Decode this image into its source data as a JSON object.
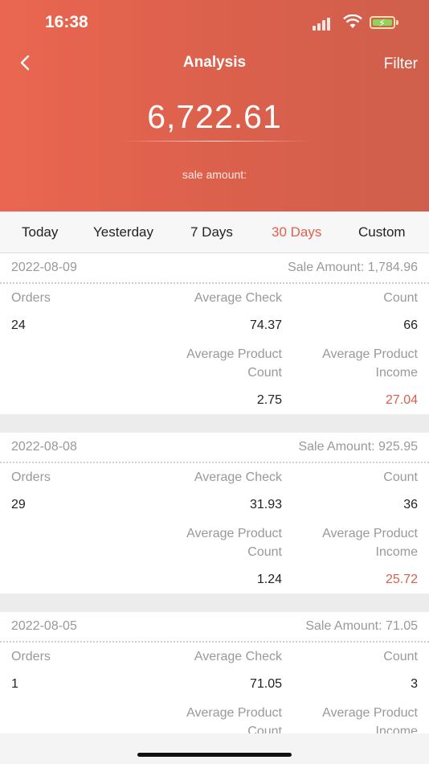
{
  "status_bar": {
    "time": "16:38"
  },
  "header": {
    "title": "Analysis",
    "filter_label": "Filter",
    "total_amount": "6,722.61",
    "amount_caption": "sale amount:"
  },
  "tabs": [
    {
      "label": "Today",
      "active": false
    },
    {
      "label": "Yesterday",
      "active": false
    },
    {
      "label": "7 Days",
      "active": false
    },
    {
      "label": "30 Days",
      "active": true
    },
    {
      "label": "Custom",
      "active": false
    }
  ],
  "colors": {
    "accent": "#E0604D",
    "header_start": "#EA6650",
    "header_end": "#CF5F4C"
  },
  "labels": {
    "orders": "Orders",
    "average_check": "Average Check",
    "count": "Count",
    "avg_product_count_1": "Average Product",
    "avg_product_count_2": "Count",
    "avg_product_income_1": "Average Product",
    "avg_product_income_2": "Income"
  },
  "records": [
    {
      "date": "2022-08-09",
      "sale_amount": "Sale Amount:  1,784.96",
      "orders": "24",
      "average_check": "74.37",
      "count": "66",
      "avg_product_count": "2.75",
      "avg_product_income": "27.04"
    },
    {
      "date": "2022-08-08",
      "sale_amount": "Sale Amount:  925.95",
      "orders": "29",
      "average_check": "31.93",
      "count": "36",
      "avg_product_count": "1.24",
      "avg_product_income": "25.72"
    },
    {
      "date": "2022-08-05",
      "sale_amount": "Sale Amount:  71.05",
      "orders": "1",
      "average_check": "71.05",
      "count": "3",
      "avg_product_count": "",
      "avg_product_income": ""
    }
  ]
}
